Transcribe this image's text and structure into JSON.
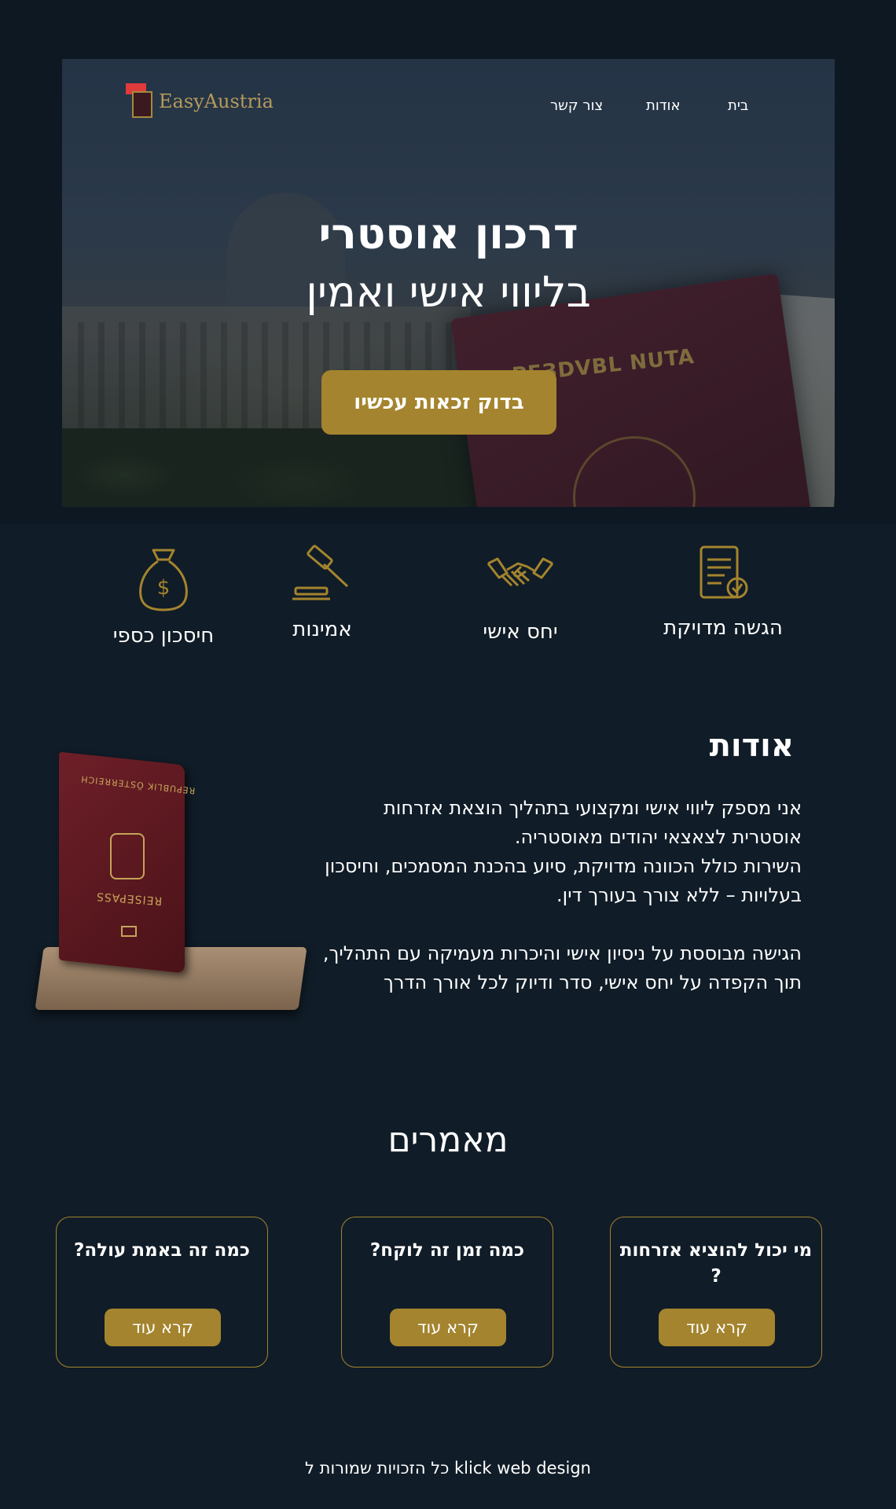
{
  "header": {
    "logo_text": "EasyAustria",
    "nav": {
      "home": "בית",
      "about": "אודות",
      "contact": "צור קשר"
    }
  },
  "hero": {
    "title_line1": "דרכון אוסטרי",
    "title_line2": "בליווי אישי ואמין",
    "cta": "בדוק זכאות עכשיו",
    "passport_title": "PEЗDVBL NUTA"
  },
  "features": [
    {
      "label": "הגשה מדויקת",
      "icon": "document-check-icon"
    },
    {
      "label": "יחס אישי",
      "icon": "handshake-icon"
    },
    {
      "label": "אמינות",
      "icon": "gavel-icon"
    },
    {
      "label": "חיסכון כספי",
      "icon": "money-bag-icon"
    }
  ],
  "about": {
    "title": "אודות",
    "para1": "אני מספק ליווי אישי ומקצועי בתהליך הוצאת אזרחות אוסטרית לצאצאי יהודים מאוסטריה.",
    "para1b": "השירות כולל הכוונה מדויקת, סיוע בהכנת המסמכים, וחיסכון בעלויות – ללא צורך בעורך דין.",
    "para2": "הגישה מבוססת על ניסיון אישי והיכרות מעמיקה עם התהליך, תוך הקפדה על יחס אישי, סדר ודיוק לכל אורך הדרך",
    "passport_text1": "REPUBLIK ÖSTERREICH",
    "passport_text2": "REISEPASS"
  },
  "articles": {
    "title": "מאמרים",
    "cards": [
      {
        "title": "מי יכול להוציא אזרחות ?",
        "button": "קרא עוד"
      },
      {
        "title": "כמה זמן זה לוקח?",
        "button": "קרא עוד"
      },
      {
        "title": "כמה זה באמת עולה?",
        "button": "קרא עוד"
      }
    ]
  },
  "footer": {
    "text": "כל הזכויות שמורות ל klick web design"
  },
  "colors": {
    "background": "#101c27",
    "gold": "#a4842e",
    "text": "#ffffff"
  }
}
